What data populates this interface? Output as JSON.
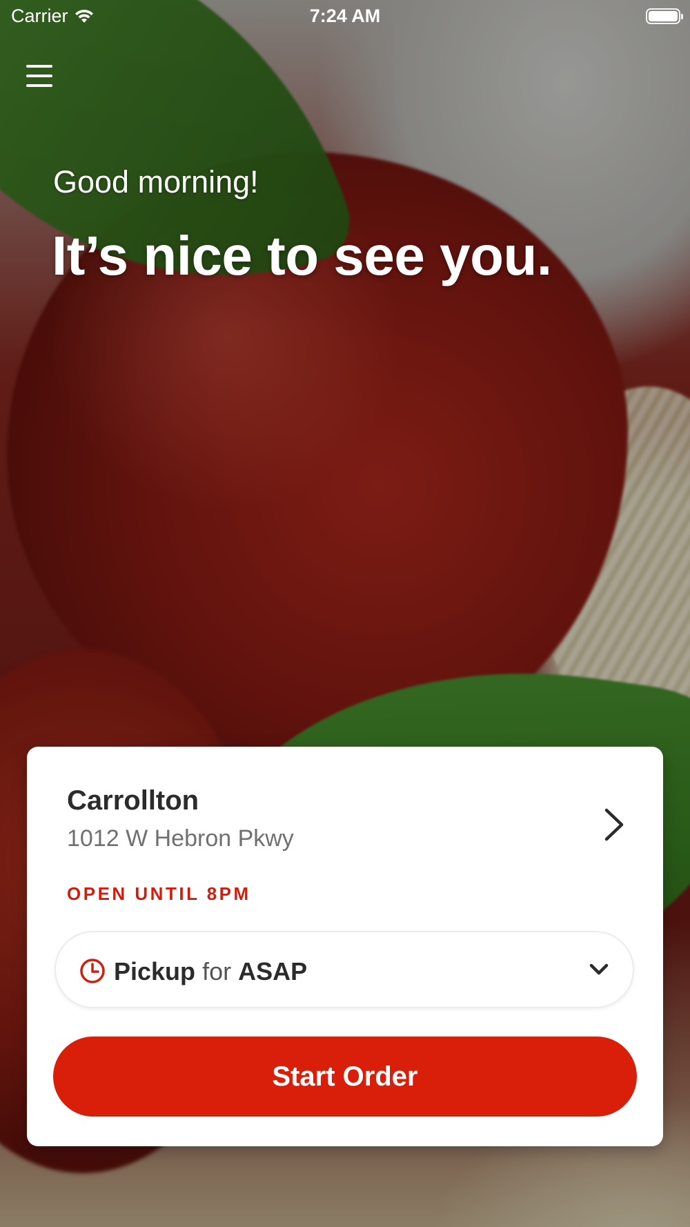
{
  "status_bar": {
    "carrier": "Carrier",
    "time": "7:24 AM",
    "wifi_icon": "wifi-icon",
    "battery_icon": "battery-icon"
  },
  "header": {
    "menu_icon": "hamburger-menu-icon"
  },
  "greeting": {
    "subtitle": "Good morning!",
    "title": "It’s nice to see you."
  },
  "location": {
    "name": "Carrollton",
    "address": "1012 W Hebron Pkwy",
    "hours": "OPEN UNTIL 8PM",
    "chevron_icon": "chevron-right-icon"
  },
  "order_type": {
    "icon": "clock-icon",
    "method": "Pickup",
    "connector": "for",
    "time": "ASAP",
    "dropdown_icon": "chevron-down-icon"
  },
  "actions": {
    "start_order_label": "Start Order"
  },
  "colors": {
    "accent": "#d91e09",
    "text_dark": "#2b2b2b",
    "text_muted": "#707070",
    "card_bg": "#ffffff"
  }
}
